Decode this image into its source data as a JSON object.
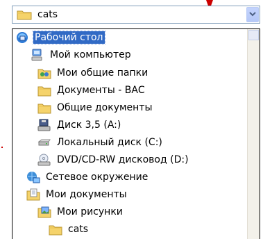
{
  "combo": {
    "value": "cats",
    "icon": "folder-icon",
    "button_icon": "chevron-down-icon"
  },
  "tree": {
    "items": [
      {
        "label": "Рабочий стол",
        "icon": "desktop-icon",
        "selected": true
      },
      {
        "label": "Мой компьютер",
        "icon": "computer-icon"
      },
      {
        "label": "Мои общие папки",
        "icon": "shared-folders-icon"
      },
      {
        "label": "Документы - ВАС",
        "icon": "folder-icon"
      },
      {
        "label": "Общие документы",
        "icon": "folder-icon"
      },
      {
        "label": "Диск 3,5 (A:)",
        "icon": "floppy-drive-icon"
      },
      {
        "label": "Локальный диск (C:)",
        "icon": "hard-drive-icon"
      },
      {
        "label": "DVD/CD-RW дисковод (D:)",
        "icon": "dvd-drive-icon"
      },
      {
        "label": "Сетевое окружение",
        "icon": "network-icon"
      },
      {
        "label": "Мои документы",
        "icon": "my-documents-icon"
      },
      {
        "label": "Мои рисунки",
        "icon": "my-pictures-icon"
      },
      {
        "label": "cats",
        "icon": "folder-icon"
      }
    ]
  },
  "colors": {
    "selection": "#316ac5",
    "border": "#7f9db9",
    "folder": "#f5d36b"
  }
}
